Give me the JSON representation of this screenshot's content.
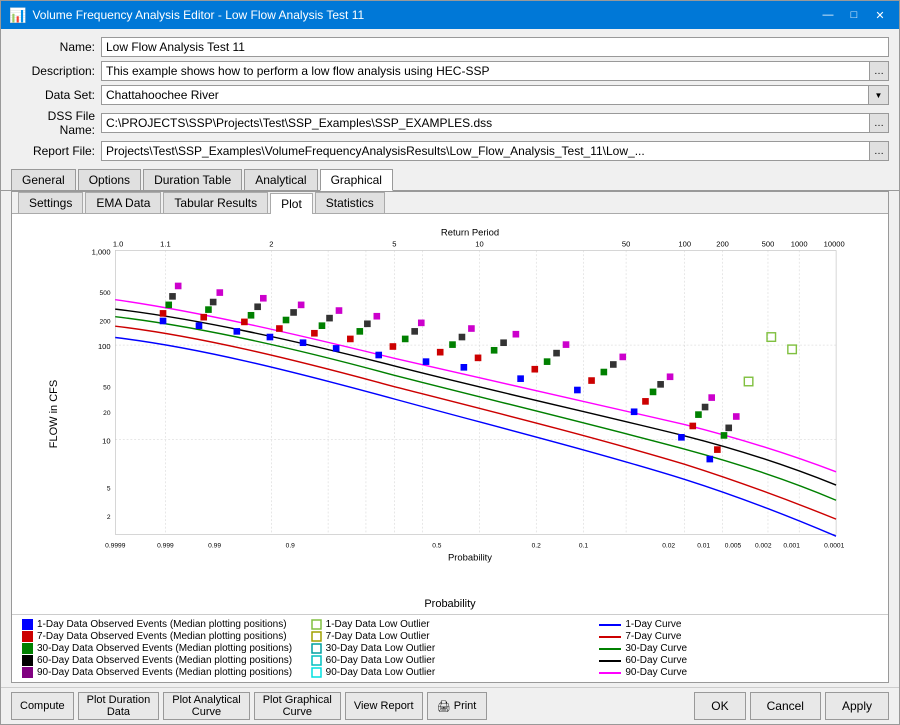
{
  "window": {
    "title": "Volume Frequency Analysis Editor - Low Flow Analysis Test 11",
    "icon": "📊"
  },
  "titlebar_controls": {
    "minimize": "—",
    "maximize": "□",
    "close": "✕"
  },
  "form": {
    "name_label": "Name:",
    "name_value": "Low Flow Analysis Test 11",
    "description_label": "Description:",
    "description_value": "This example shows how to perform a low flow analysis using HEC-SSP",
    "dataset_label": "Data Set:",
    "dataset_value": "Chattahoochee River",
    "dss_label": "DSS File Name:",
    "dss_value": "C:\\PROJECTS\\SSP\\Projects\\Test\\SSP_Examples\\SSP_EXAMPLES.dss",
    "report_label": "Report File:",
    "report_value": "Projects\\Test\\SSP_Examples\\VolumeFrequencyAnalysisResults\\Low_Flow_Analysis_Test_11\\Low_..."
  },
  "outer_tabs": [
    {
      "label": "General",
      "active": false
    },
    {
      "label": "Options",
      "active": false
    },
    {
      "label": "Duration Table",
      "active": false
    },
    {
      "label": "Analytical",
      "active": false
    },
    {
      "label": "Graphical",
      "active": true
    }
  ],
  "inner_tabs": [
    {
      "label": "Settings",
      "active": false
    },
    {
      "label": "EMA Data",
      "active": false
    },
    {
      "label": "Tabular Results",
      "active": false
    },
    {
      "label": "Plot",
      "active": true
    },
    {
      "label": "Statistics",
      "active": false
    }
  ],
  "chart": {
    "title": "Return Period",
    "x_label": "Probability",
    "y_label": "FLOW in CFS",
    "x_top_ticks": [
      "1.0",
      "1.1",
      "2",
      "5",
      "10",
      "50",
      "100",
      "200",
      "500",
      "1000",
      "10000"
    ],
    "y_ticks": [
      "1,000",
      "100",
      "10"
    ],
    "x_bottom_ticks": [
      "0.9999",
      "0.999",
      "0.99",
      "0.9",
      "0.5",
      "0.2",
      "0.1",
      "0.02",
      "0.01",
      "0.005",
      "0.002",
      "0.001",
      "0.0001"
    ]
  },
  "legend": [
    {
      "type": "square",
      "color": "#0000ff",
      "label": "1-Day Data Observed Events (Median plotting positions)"
    },
    {
      "type": "square-outline",
      "color": "#80c040",
      "label": "1-Day Data Low Outlier"
    },
    {
      "type": "line",
      "color": "#0000ff",
      "label": "1-Day Curve"
    },
    {
      "type": "square",
      "color": "#cc0000",
      "label": "7-Day Data Observed Events (Median plotting positions)"
    },
    {
      "type": "square-outline",
      "color": "#a0a000",
      "label": "7-Day Data Low Outlier"
    },
    {
      "type": "line",
      "color": "#cc0000",
      "label": "7-Day Curve"
    },
    {
      "type": "square",
      "color": "#008000",
      "label": "30-Day Data Observed Events (Median plotting positions)"
    },
    {
      "type": "square-outline",
      "color": "#00a0a0",
      "label": "30-Day Data Low Outlier"
    },
    {
      "type": "line",
      "color": "#008000",
      "label": "30-Day Curve"
    },
    {
      "type": "square",
      "color": "#000000",
      "label": "60-Day Data Observed Events (Median plotting positions)"
    },
    {
      "type": "square-outline",
      "color": "#00c0c0",
      "label": "60-Day Data Low Outlier"
    },
    {
      "type": "line",
      "color": "#000000",
      "label": "60-Day Curve"
    },
    {
      "type": "square",
      "color": "#800080",
      "label": "90-Day Data Observed Events (Median plotting positions)"
    },
    {
      "type": "square-outline",
      "color": "#00e0e0",
      "label": "90-Day Data Low Outlier"
    },
    {
      "type": "line",
      "color": "#ff00ff",
      "label": "90-Day Curve"
    }
  ],
  "bottom_buttons": {
    "compute": "Compute",
    "plot_duration_data": "Plot Duration\nData",
    "plot_analytical_curve": "Plot Analytical\nCurve",
    "plot_graphical_curve": "Plot Graphical\nCurve",
    "view_report": "View Report",
    "print": "🖨 Print",
    "ok": "OK",
    "cancel": "Cancel",
    "apply": "Apply"
  }
}
